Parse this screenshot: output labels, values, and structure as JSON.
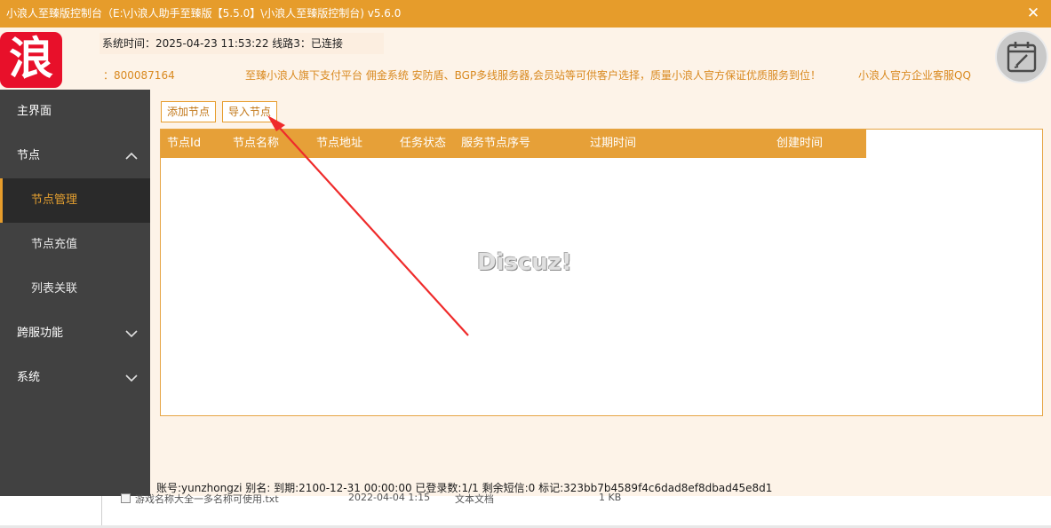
{
  "window": {
    "title": "小浪人至臻版控制台（E:\\小浪人助手至臻版【5.5.0】\\小浪人至臻版控制台) v5.6.0",
    "close_icon": "close-icon"
  },
  "header": {
    "logo_text": "浪",
    "system_info": "系统时间：2025-04-23 11:53:22  线路3：已连接",
    "qq_number": "：800087164",
    "marquee": "至臻小浪人旗下支付平台   佣金系统   安防盾、BGP多线服务器,会员站等可供客户选择，质量小浪人官方保证优质服务到位！",
    "service_link": "小浪人官方企业客服QQ",
    "calendar_icon": "calendar-edit-icon"
  },
  "sidebar": {
    "items": [
      {
        "label": "主界面"
      },
      {
        "label": "节点",
        "icon": "chevron-up-icon"
      },
      {
        "label": "节点管理"
      },
      {
        "label": "节点充值"
      },
      {
        "label": "列表关联"
      },
      {
        "label": "跨服功能",
        "icon": "chevron-down-icon"
      },
      {
        "label": "系统",
        "icon": "chevron-down-icon"
      }
    ]
  },
  "toolbar": {
    "add_label": "添加节点",
    "import_label": "导入节点"
  },
  "table": {
    "columns": [
      "节点Id",
      "节点名称",
      "节点地址",
      "任务状态",
      "服务节点序号",
      "过期时间",
      "创建时间"
    ],
    "rows": []
  },
  "watermark": "Discuz!",
  "status": {
    "text": "账号:yunzhongzi 别名: 到期:2100-12-31 00:00:00 已登录数:1/1 剩余短信:0 标记:323bb7b4589f4c6dad8ef8dbad45e8d1"
  },
  "background_window": {
    "file_name": "游戏名称大全一多名称可使用.txt",
    "file_date": "2022-04-04 1:15",
    "file_type": "文本文档",
    "file_size": "1 KB"
  },
  "colors": {
    "accent": "#e69c2b",
    "sidebar_bg": "#414141",
    "logo_red": "#e8102a",
    "arrow_red": "#ef2b2b"
  }
}
